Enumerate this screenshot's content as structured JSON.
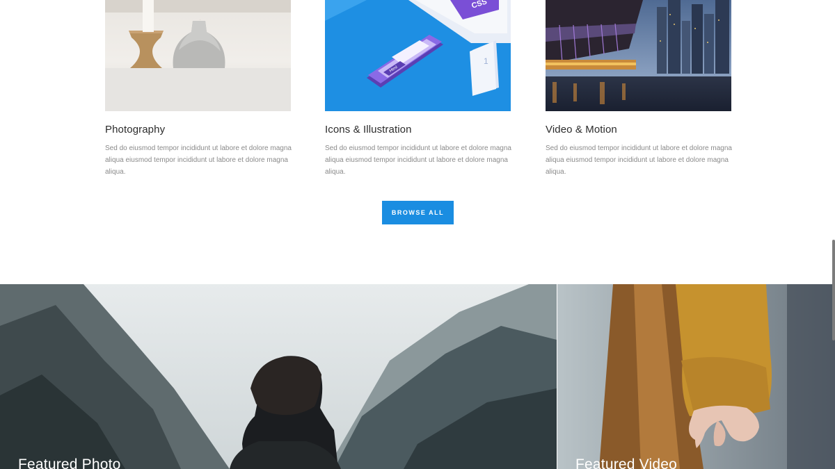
{
  "categories": [
    {
      "title": "Photography",
      "description": "Sed do eiusmod tempor incididunt ut labore et dolore magna aliqua eiusmod tempor incididunt ut labore et dolore magna aliqua.",
      "image_label": "Photography image"
    },
    {
      "title": "Icons & Illustration",
      "description": "Sed do eiusmod tempor incididunt ut labore et dolore magna aliqua eiusmod tempor incididunt ut labore et dolore magna aliqua.",
      "image_label": "Icons illustration image",
      "illustration_text": {
        "tag": "CSS",
        "phone_label": "Html",
        "number": "1"
      }
    },
    {
      "title": "Video & Motion",
      "description": "Sed do eiusmod tempor incididunt ut labore et dolore magna aliqua eiusmod tempor incididunt ut labore et dolore magna aliqua.",
      "image_label": "City bridge at night image"
    }
  ],
  "browse_button": {
    "label": "BROWSE ALL"
  },
  "featured": {
    "photo": {
      "label": "Featured Photo"
    },
    "video": {
      "label": "Featured Video"
    }
  },
  "colors": {
    "accent": "#1a8de1",
    "title_text": "#2b2b2b",
    "body_text": "#8a8a8a",
    "illustration_blue": "#1e8fe3",
    "illustration_purple": "#7a4fd6"
  },
  "icons": {
    "scrollbar": "scrollbar"
  }
}
